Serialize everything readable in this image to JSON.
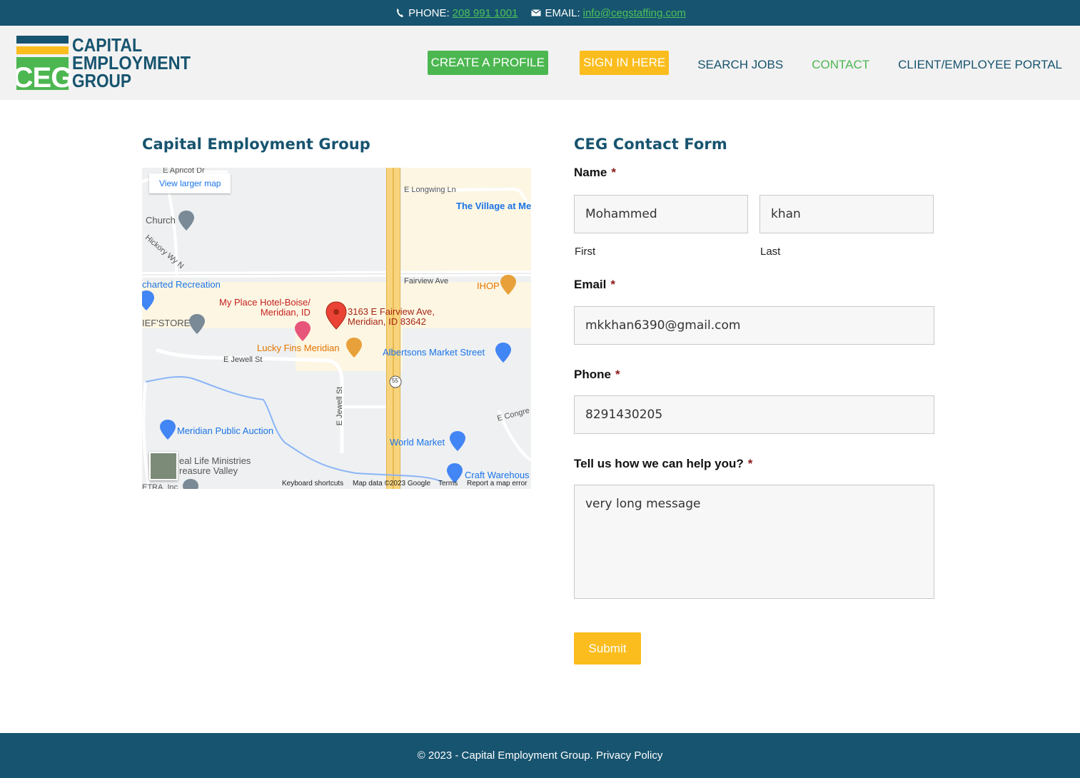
{
  "topbar": {
    "phone_label": "PHONE:",
    "phone_number": "208 991 1001",
    "email_label": "EMAIL:",
    "email_address": "info@cegstaffing.com"
  },
  "logo": {
    "line1": "CAPITAL",
    "line2": "EMPLOYMENT",
    "line3": "GROUP",
    "mark": "CEG"
  },
  "nav": {
    "create_profile": "CREATE A PROFILE",
    "sign_in": "SIGN IN HERE",
    "search_jobs": "SEARCH JOBS",
    "contact": "CONTACT",
    "portal": "CLIENT/EMPLOYEE PORTAL"
  },
  "left": {
    "heading": "Capital Employment Group"
  },
  "map": {
    "view_larger": "View larger map",
    "labels": {
      "apricot": "E Apricot Dr",
      "longwing": "E Longwing Ln",
      "village": "The Village at Me",
      "church": "Church",
      "hickory": "Hickory Wy N",
      "recreation": "charted Recreation",
      "fairview": "Fairview Ave",
      "ihop": "IHOP",
      "hotel": "My Place Hotel-Boise/\nMeridian, ID",
      "address": "3163 E Fairview Ave,\nMeridian, ID 83642",
      "chefstore": "IEF'STORE",
      "luckyfins": "Lucky Fins Meridian",
      "albertsons": "Albertsons Market Street",
      "jewell": "E Jewell St",
      "jewell_v": "E Jewell St",
      "route": "55",
      "congress": "E Congre",
      "public_auction": "Meridian Public Auction",
      "world_market": "World Market",
      "real_life": "eal Life Ministries\nreasure Valley",
      "craft": "Craft Warehous",
      "etra": "ETRA, Inc"
    },
    "footer": {
      "shortcuts": "Keyboard shortcuts",
      "mapdata": "Map data ©2023 Google",
      "terms": "Terms",
      "report": "Report a map error"
    }
  },
  "form": {
    "heading": "CEG Contact Form",
    "name_label": "Name",
    "required_mark": "*",
    "first_value": "Mohammed",
    "last_value": "khan",
    "first_sub": "First",
    "last_sub": "Last",
    "email_label": "Email",
    "email_value": "mkkhan6390@gmail.com",
    "phone_label": "Phone",
    "phone_value": "8291430205",
    "message_label": "Tell us how we can help you?",
    "message_value": "very long message",
    "submit": "Submit"
  },
  "footer": {
    "text": "© 2023 - Capital Employment Group. Privacy Policy"
  },
  "colors": {
    "primary": "#17546f",
    "green": "#4cb751",
    "yellow": "#fbbd1e"
  }
}
